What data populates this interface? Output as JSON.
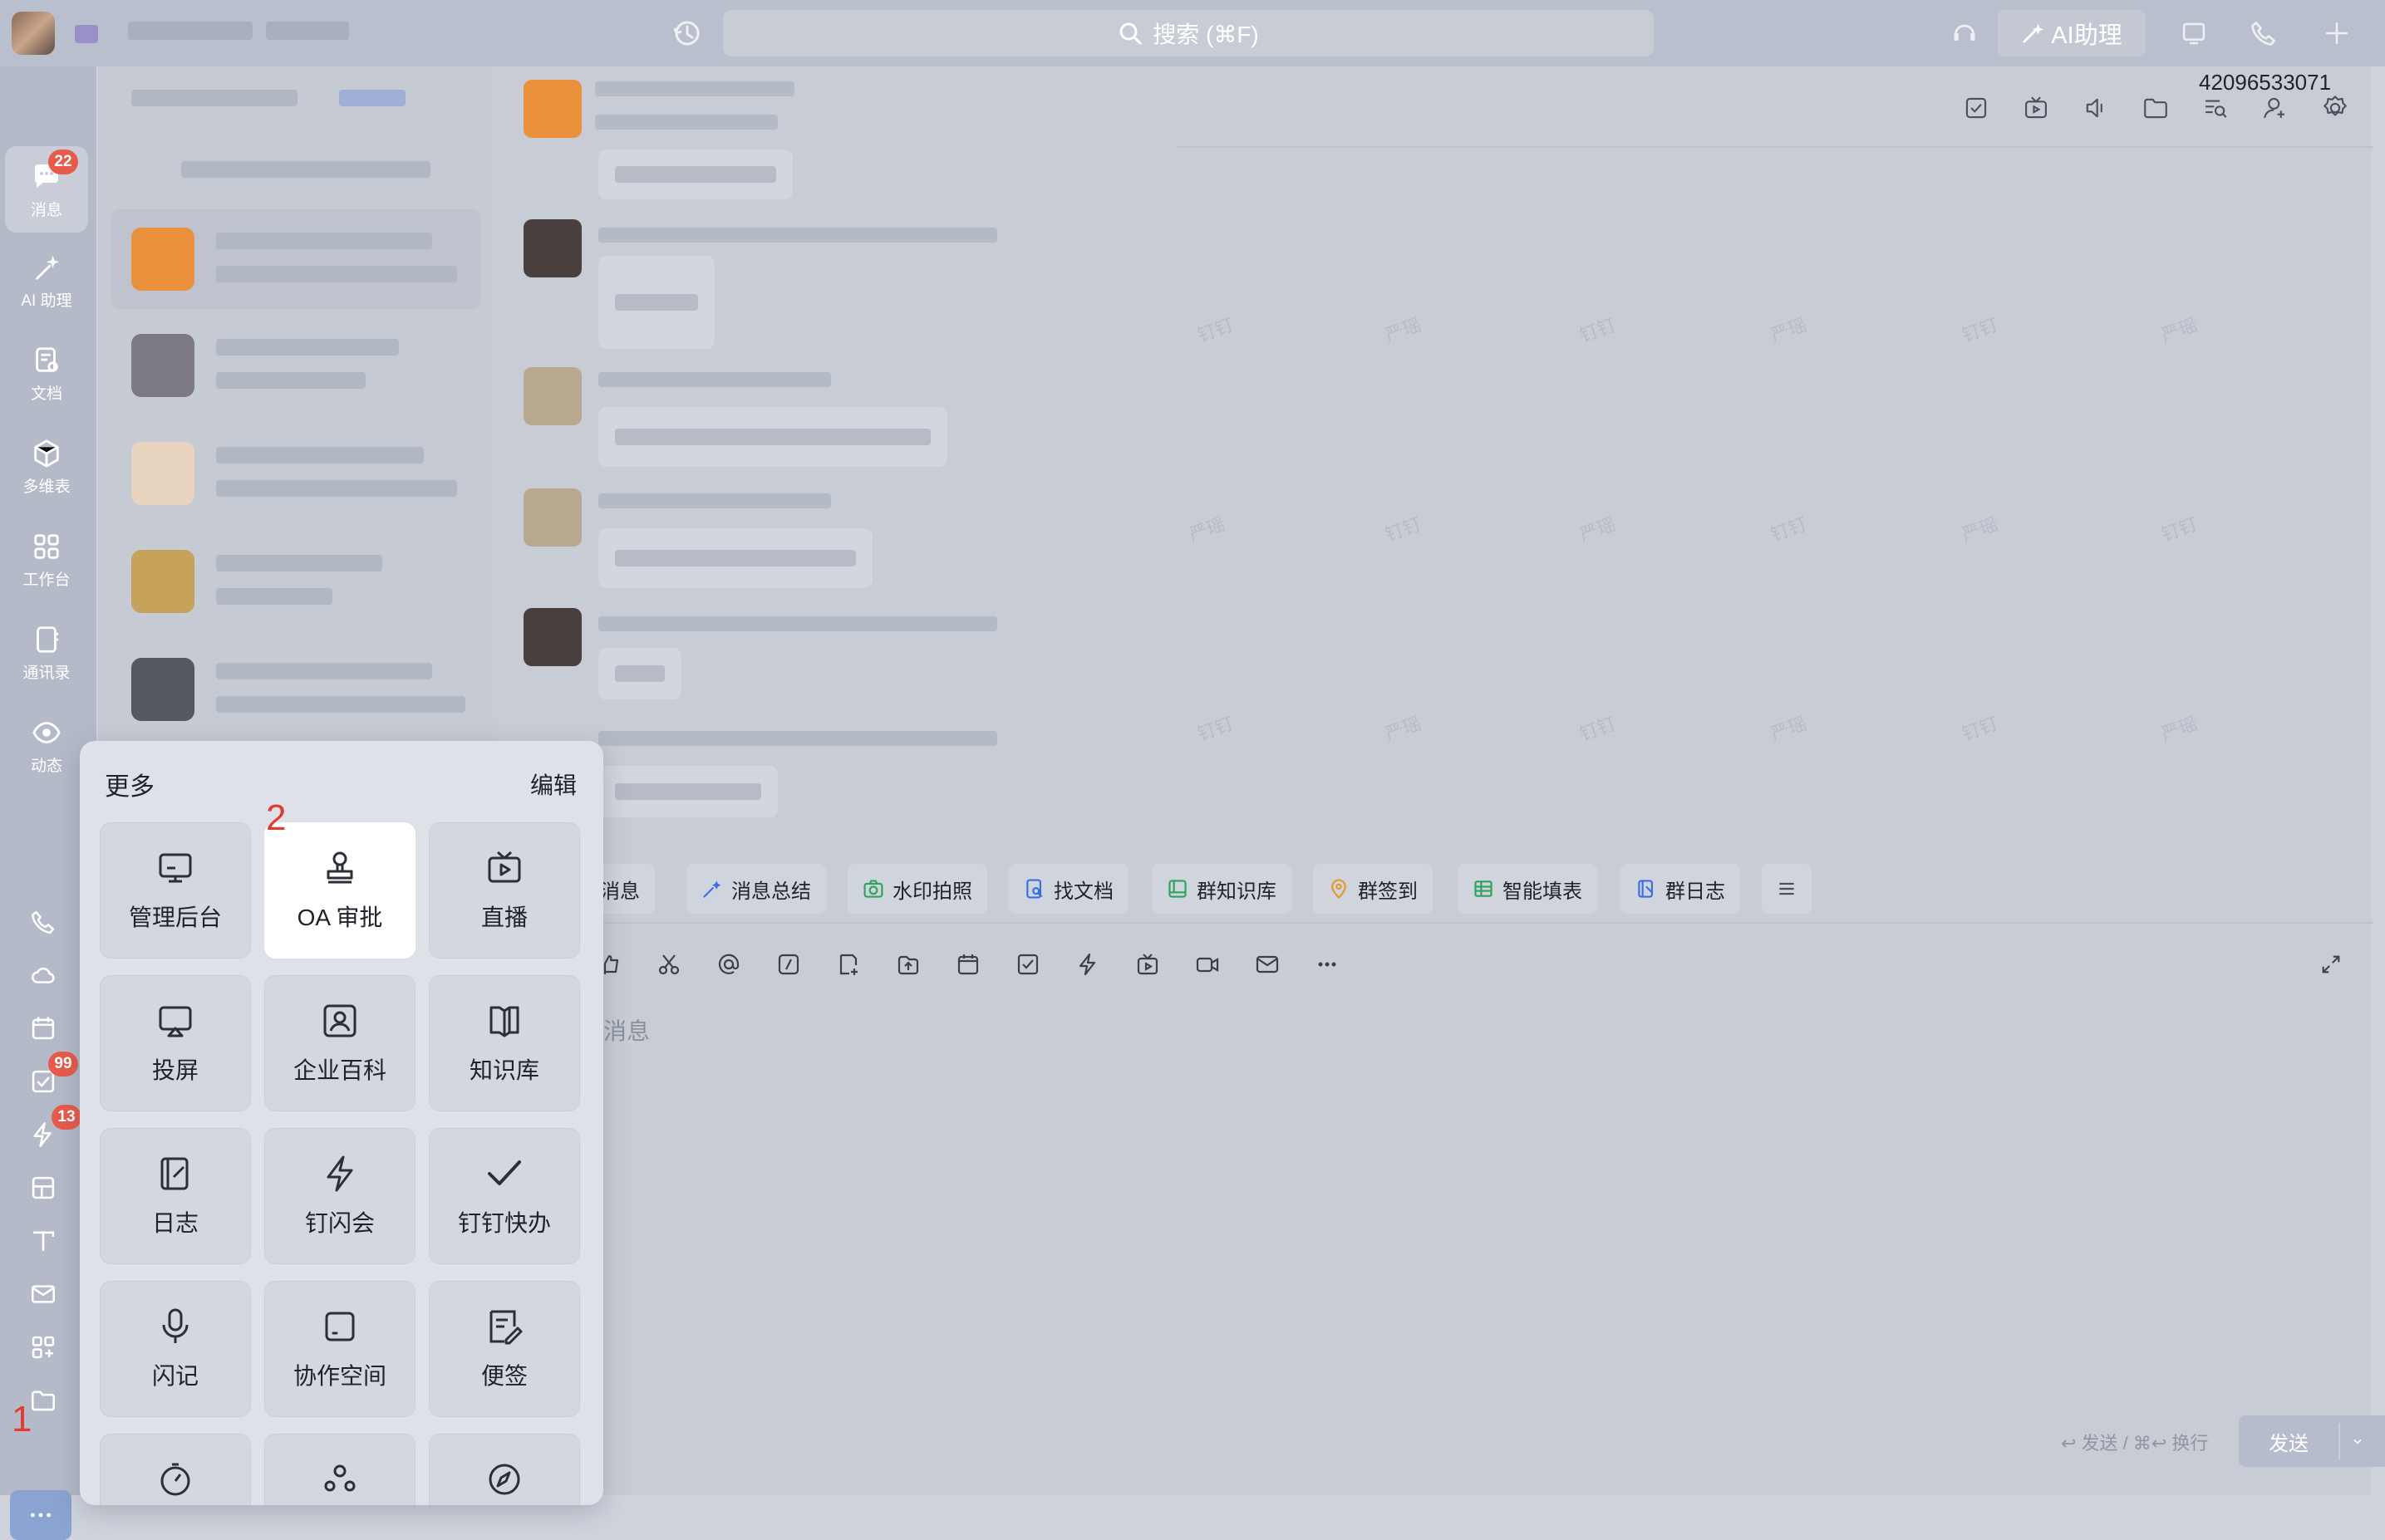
{
  "topbar": {
    "search_placeholder": "搜索 (⌘F)",
    "ai_assistant_label": "AI助理"
  },
  "rail": {
    "items": [
      {
        "label": "消息",
        "icon": "chat-icon",
        "badge": "22",
        "active": true
      },
      {
        "label": "AI 助理",
        "icon": "ai-sparkle-icon"
      },
      {
        "label": "文档",
        "icon": "document-icon"
      },
      {
        "label": "多维表",
        "icon": "cube-icon"
      },
      {
        "label": "工作台",
        "icon": "grid-icon"
      },
      {
        "label": "通讯录",
        "icon": "contacts-icon"
      },
      {
        "label": "动态",
        "icon": "eye-icon"
      }
    ],
    "small_icons": [
      {
        "icon": "phone-icon"
      },
      {
        "icon": "cloud-icon"
      },
      {
        "icon": "calendar-icon"
      },
      {
        "icon": "todo-icon",
        "badge": "99"
      },
      {
        "icon": "lightning-icon",
        "badge": "13"
      },
      {
        "icon": "checklist-icon"
      },
      {
        "icon": "text-icon"
      },
      {
        "icon": "mail-icon"
      },
      {
        "icon": "apps-icon"
      },
      {
        "icon": "folder-icon"
      }
    ],
    "step_label": "1"
  },
  "chat": {
    "conversation_id": "42096533071",
    "input_placeholder": "消息",
    "send_hint": "↩ 发送 / ⌘↩ 换行",
    "send_label": "发送",
    "quick_actions": [
      {
        "label": "主消息",
        "icon": "message-icon"
      },
      {
        "label": "消息总结",
        "icon": "sparkle-icon"
      },
      {
        "label": "水印拍照",
        "icon": "camera-icon",
        "color": "#2fa35b"
      },
      {
        "label": "找文档",
        "icon": "doc-search-icon",
        "color": "#3a6ee8"
      },
      {
        "label": "群知识库",
        "icon": "book-icon",
        "color": "#2fa35b"
      },
      {
        "label": "群签到",
        "icon": "location-icon",
        "color": "#e39a2c"
      },
      {
        "label": "智能填表",
        "icon": "table-icon",
        "color": "#2fa35b"
      },
      {
        "label": "群日志",
        "icon": "log-icon",
        "color": "#3a6ee8"
      }
    ],
    "watermark_texts": [
      "钉钉",
      "严瑶"
    ]
  },
  "popup": {
    "title": "更多",
    "edit_label": "编辑",
    "step_label": "2",
    "tiles": [
      {
        "label": "管理后台",
        "icon": "admin-monitor-icon"
      },
      {
        "label": "OA 审批",
        "icon": "stamp-icon",
        "highlighted": true
      },
      {
        "label": "直播",
        "icon": "tv-play-icon"
      },
      {
        "label": "投屏",
        "icon": "screen-cast-icon"
      },
      {
        "label": "企业百科",
        "icon": "encyclopedia-icon"
      },
      {
        "label": "知识库",
        "icon": "knowledge-book-icon"
      },
      {
        "label": "日志",
        "icon": "journal-icon"
      },
      {
        "label": "钉闪会",
        "icon": "flash-meeting-icon"
      },
      {
        "label": "钉钉快办",
        "icon": "quick-check-icon"
      },
      {
        "label": "闪记",
        "icon": "mic-icon"
      },
      {
        "label": "协作空间",
        "icon": "workspace-icon"
      },
      {
        "label": "便签",
        "icon": "note-icon"
      }
    ]
  },
  "colors": {
    "accent": "#3a6ee8",
    "badge": "#e85a4a",
    "step": "#e33b32"
  }
}
